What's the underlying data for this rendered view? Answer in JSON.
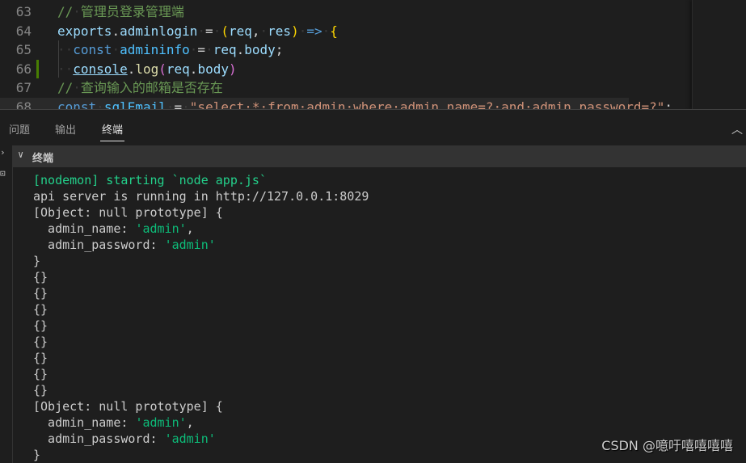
{
  "editor": {
    "lines": [
      {
        "num": "63",
        "segs": [
          {
            "t": "//",
            "c": "cm"
          },
          {
            "t": "·",
            "c": "ws"
          },
          {
            "t": "管理员登录管理端",
            "c": "cm"
          }
        ]
      },
      {
        "num": "64",
        "segs": [
          {
            "t": "exports",
            "c": "var"
          },
          {
            "t": ".",
            "c": "op"
          },
          {
            "t": "adminlogin",
            "c": "var"
          },
          {
            "t": "·",
            "c": "ws"
          },
          {
            "t": "=",
            "c": "op"
          },
          {
            "t": "·",
            "c": "ws"
          },
          {
            "t": "(",
            "c": "p1"
          },
          {
            "t": "req",
            "c": "var"
          },
          {
            "t": ",",
            "c": "op"
          },
          {
            "t": "·",
            "c": "ws"
          },
          {
            "t": "res",
            "c": "var"
          },
          {
            "t": ")",
            "c": "p1"
          },
          {
            "t": "·",
            "c": "ws"
          },
          {
            "t": "=>",
            "c": "kw"
          },
          {
            "t": "·",
            "c": "ws"
          },
          {
            "t": "{",
            "c": "p1"
          }
        ]
      },
      {
        "num": "65",
        "segs": [
          {
            "t": "··",
            "c": "ws"
          },
          {
            "t": "const",
            "c": "kw"
          },
          {
            "t": "·",
            "c": "ws"
          },
          {
            "t": "admininfo",
            "c": "cvar"
          },
          {
            "t": "·",
            "c": "ws"
          },
          {
            "t": "=",
            "c": "op"
          },
          {
            "t": "·",
            "c": "ws"
          },
          {
            "t": "req",
            "c": "var"
          },
          {
            "t": ".",
            "c": "op"
          },
          {
            "t": "body",
            "c": "var"
          },
          {
            "t": ";",
            "c": "op"
          }
        ]
      },
      {
        "num": "66",
        "modified": true,
        "segs": [
          {
            "t": "··",
            "c": "ws"
          },
          {
            "t": "console",
            "c": "var u"
          },
          {
            "t": ".",
            "c": "op"
          },
          {
            "t": "log",
            "c": "fn"
          },
          {
            "t": "(",
            "c": "p2"
          },
          {
            "t": "req",
            "c": "var"
          },
          {
            "t": ".",
            "c": "op"
          },
          {
            "t": "body",
            "c": "var"
          },
          {
            "t": ")",
            "c": "p2"
          }
        ]
      },
      {
        "num": "67",
        "segs": [
          {
            "t": "//",
            "c": "cm"
          },
          {
            "t": "·",
            "c": "ws"
          },
          {
            "t": "查询输入的邮箱是否存在",
            "c": "cm"
          }
        ]
      },
      {
        "num": "68",
        "highlight": true,
        "segs": [
          {
            "t": "const",
            "c": "kw"
          },
          {
            "t": "·",
            "c": "ws"
          },
          {
            "t": "sqlEmail",
            "c": "cvar"
          },
          {
            "t": "·",
            "c": "ws"
          },
          {
            "t": "=",
            "c": "op"
          },
          {
            "t": "·",
            "c": "ws"
          },
          {
            "t": "\"select·*·from·admin·where·admin_name=?·and·admin_password=?\"",
            "c": "str"
          },
          {
            "t": ";",
            "c": "op"
          }
        ]
      }
    ]
  },
  "panel": {
    "tabs": [
      {
        "label": "问题"
      },
      {
        "label": "输出"
      },
      {
        "label": "终端",
        "active": true
      }
    ],
    "terminal_title": "终端",
    "icons": {
      "collapse": "chevron-up-icon",
      "section": "chevron-down-icon"
    }
  },
  "terminal": {
    "lines": [
      [
        {
          "t": "[nodemon] starting `node app.js`",
          "c": "g"
        }
      ],
      [
        {
          "t": "api server is running in http://127.0.0.1:8029",
          "c": ""
        }
      ],
      [
        {
          "t": "[Object: null prototype] {",
          "c": ""
        }
      ],
      [
        {
          "t": "  admin_name: ",
          "c": ""
        },
        {
          "t": "'admin'",
          "c": "s"
        },
        {
          "t": ",",
          "c": ""
        }
      ],
      [
        {
          "t": "  admin_password: ",
          "c": ""
        },
        {
          "t": "'admin'",
          "c": "s"
        }
      ],
      [
        {
          "t": "}",
          "c": ""
        }
      ],
      [
        {
          "t": "{}",
          "c": ""
        }
      ],
      [
        {
          "t": "{}",
          "c": ""
        }
      ],
      [
        {
          "t": "{}",
          "c": ""
        }
      ],
      [
        {
          "t": "{}",
          "c": ""
        }
      ],
      [
        {
          "t": "{}",
          "c": ""
        }
      ],
      [
        {
          "t": "{}",
          "c": ""
        }
      ],
      [
        {
          "t": "{}",
          "c": ""
        }
      ],
      [
        {
          "t": "{}",
          "c": ""
        }
      ],
      [
        {
          "t": "[Object: null prototype] {",
          "c": ""
        }
      ],
      [
        {
          "t": "  admin_name: ",
          "c": ""
        },
        {
          "t": "'admin'",
          "c": "s"
        },
        {
          "t": ",",
          "c": ""
        }
      ],
      [
        {
          "t": "  admin_password: ",
          "c": ""
        },
        {
          "t": "'admin'",
          "c": "s"
        }
      ],
      [
        {
          "t": "}",
          "c": ""
        }
      ]
    ]
  },
  "watermark": "CSDN @噫吁嘻嘻嘻嘻"
}
